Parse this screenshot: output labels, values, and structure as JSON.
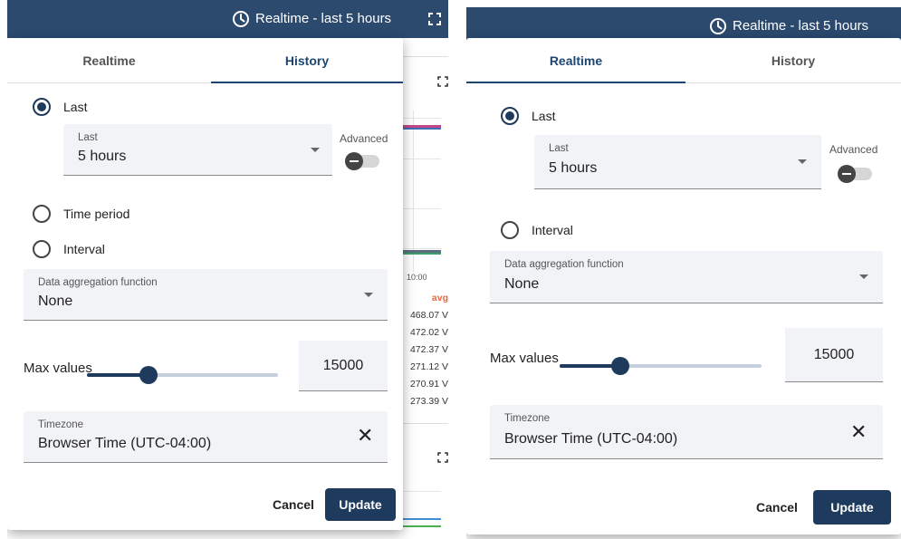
{
  "left_panel": {
    "header": {
      "title": "Realtime - last 5 hours",
      "clock_icon": "clock-icon",
      "fullscreen_icon": "fullscreen-icon"
    },
    "tabs": [
      {
        "label": "Realtime",
        "active": false
      },
      {
        "label": "History",
        "active": true
      }
    ],
    "options": {
      "last": {
        "label": "Last",
        "selected": true
      },
      "last_field": {
        "label": "Last",
        "value": "5 hours"
      },
      "advanced": {
        "label": "Advanced",
        "on": false
      },
      "time_period": {
        "label": "Time period",
        "selected": false
      },
      "interval": {
        "label": "Interval",
        "selected": false
      }
    },
    "aggregation": {
      "label": "Data aggregation function",
      "value": "None"
    },
    "max_values": {
      "label": "Max values",
      "value": "15000",
      "slider_fraction": 0.32
    },
    "timezone": {
      "label": "Timezone",
      "value": "Browser Time (UTC-04:00)"
    },
    "actions": {
      "cancel": "Cancel",
      "update": "Update"
    },
    "background": {
      "axis_tick": "10:00",
      "legend_header": "avg",
      "legend_values": [
        "468.07 V",
        "472.02 V",
        "472.37 V",
        "271.12 V",
        "270.91 V",
        "273.39 V"
      ]
    }
  },
  "right_panel": {
    "header": {
      "title": "Realtime - last 5 hours",
      "clock_icon": "clock-icon"
    },
    "tabs": [
      {
        "label": "Realtime",
        "active": true
      },
      {
        "label": "History",
        "active": false
      }
    ],
    "options": {
      "last": {
        "label": "Last",
        "selected": true
      },
      "last_field": {
        "label": "Last",
        "value": "5 hours"
      },
      "advanced": {
        "label": "Advanced",
        "on": false
      },
      "interval": {
        "label": "Interval",
        "selected": false
      }
    },
    "aggregation": {
      "label": "Data aggregation function",
      "value": "None"
    },
    "max_values": {
      "label": "Max values",
      "value": "15000",
      "slider_fraction": 0.3
    },
    "timezone": {
      "label": "Timezone",
      "value": "Browser Time (UTC-04:00)"
    },
    "actions": {
      "cancel": "Cancel",
      "update": "Update"
    }
  },
  "colors": {
    "header_bg": "#2b4a6e",
    "primary": "#1e3a5c",
    "avg_label": "#e8663d"
  }
}
